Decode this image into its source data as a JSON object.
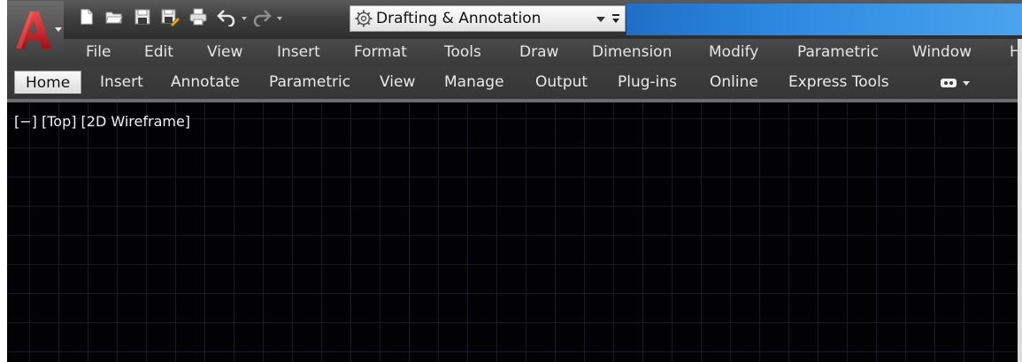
{
  "quick_access": {
    "icons": [
      "new-icon",
      "open-icon",
      "save-icon",
      "save-as-icon",
      "plot-icon",
      "undo-icon",
      "redo-icon"
    ],
    "workspace": {
      "label": "Drafting & Annotation",
      "icon": "gear-icon"
    }
  },
  "menubar": {
    "items": [
      "File",
      "Edit",
      "View",
      "Insert",
      "Format",
      "Tools",
      "Draw",
      "Dimension",
      "Modify",
      "Parametric",
      "Window",
      "H"
    ]
  },
  "ribbon": {
    "tabs": [
      "Home",
      "Insert",
      "Annotate",
      "Parametric",
      "View",
      "Manage",
      "Output",
      "Plug-ins",
      "Online",
      "Express Tools"
    ],
    "active_tab": "Home",
    "extra_icon": "video-camera-icon"
  },
  "viewport": {
    "label": "[−] [Top] [2D Wireframe]"
  },
  "colors": {
    "canvas_bg": "#020205",
    "grid_line": "#1a1b22",
    "title_accent": "#2d8ae0",
    "logo_red": "#d11f26"
  }
}
